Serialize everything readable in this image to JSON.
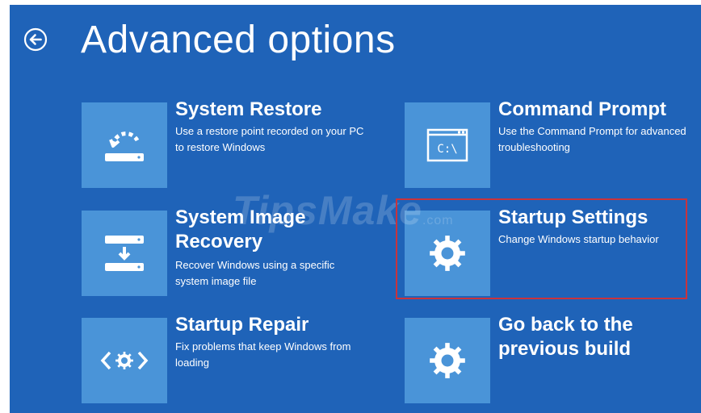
{
  "title": "Advanced options",
  "watermark": {
    "brand": "TipsMake",
    "suffix": ".com"
  },
  "options": [
    {
      "title": "System Restore",
      "description": "Use a restore point recorded on your PC to restore Windows",
      "icon": "system-restore-icon"
    },
    {
      "title": "Command Prompt",
      "description": "Use the Command Prompt for advanced troubleshooting",
      "icon": "command-prompt-icon",
      "icon_text": "C:\\"
    },
    {
      "title": "System Image Recovery",
      "description": "Recover Windows using a specific system image file",
      "icon": "system-image-icon"
    },
    {
      "title": "Startup Settings",
      "description": "Change Windows startup behavior",
      "icon": "gear-icon",
      "highlighted": true
    },
    {
      "title": "Startup Repair",
      "description": "Fix problems that keep Windows from loading",
      "icon": "startup-repair-icon"
    },
    {
      "title": "Go back to the previous build",
      "description": "",
      "icon": "gear-icon"
    }
  ],
  "colors": {
    "background": "#1f63b8",
    "tile": "#4a94d8",
    "highlight": "#c9333c",
    "text": "#ffffff"
  }
}
